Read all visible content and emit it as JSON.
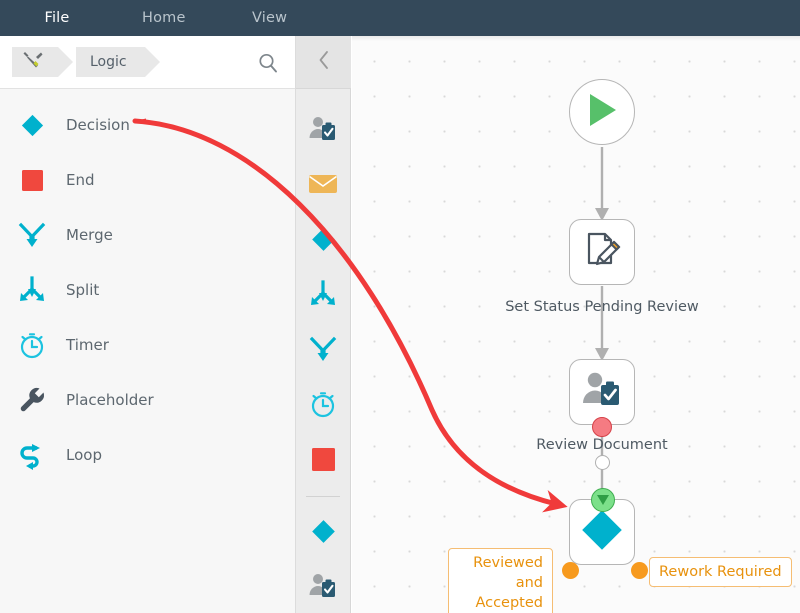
{
  "menubar": {
    "items": [
      {
        "label": "File",
        "active": true
      },
      {
        "label": "Home",
        "active": false
      },
      {
        "label": "View",
        "active": false
      }
    ]
  },
  "breadcrumb": {
    "home_icon": "tools-icon",
    "current": "Logic",
    "search_icon": "search-icon"
  },
  "sidebar": {
    "collapse_icon": "chevron-left-icon",
    "items": [
      {
        "label": "Decision",
        "icon": "diamond-icon",
        "color": "#00b1cd"
      },
      {
        "label": "End",
        "icon": "square-icon",
        "color": "#f0483e"
      },
      {
        "label": "Merge",
        "icon": "merge-arrow-icon",
        "color": "#00b1cd"
      },
      {
        "label": "Split",
        "icon": "split-arrow-icon",
        "color": "#00b1cd"
      },
      {
        "label": "Timer",
        "icon": "alarm-clock-icon",
        "color": "#1cc3e0"
      },
      {
        "label": "Placeholder",
        "icon": "wrench-icon",
        "color": "#4a5560"
      },
      {
        "label": "Loop",
        "icon": "loop-icon",
        "color": "#00b1cd"
      }
    ]
  },
  "toolstrip": {
    "items": [
      {
        "name": "user-task-icon"
      },
      {
        "name": "envelope-icon"
      },
      {
        "name": "diamond-icon"
      },
      {
        "name": "split-arrow-icon"
      },
      {
        "name": "merge-arrow-icon"
      },
      {
        "name": "alarm-clock-icon"
      },
      {
        "name": "square-end-icon"
      },
      {
        "name": "divider"
      },
      {
        "name": "diamond-icon"
      },
      {
        "name": "user-task-icon"
      }
    ]
  },
  "canvas": {
    "nodes": [
      {
        "id": "start",
        "type": "start",
        "icon": "play-icon",
        "label": ""
      },
      {
        "id": "set-status",
        "type": "task",
        "icon": "document-edit-icon",
        "label": "Set Status Pending Review"
      },
      {
        "id": "review",
        "type": "user-task",
        "icon": "user-task-icon",
        "label": "Review Document"
      },
      {
        "id": "decision",
        "type": "decision",
        "icon": "diamond-icon",
        "label": ""
      }
    ],
    "branch_labels": [
      {
        "text": "Reviewed and Accepted",
        "side": "left"
      },
      {
        "text": "Rework Required",
        "side": "right"
      }
    ]
  },
  "annotation": {
    "arrow": "red-curved-arrow",
    "color": "#f03a3a",
    "from": "Decision",
    "to": "decision-node"
  },
  "colors": {
    "menubar_bg": "#34495a",
    "accent_cyan": "#00b1cd",
    "accent_orange": "#f79a1e",
    "accent_red": "#f0483e",
    "accent_green": "#57c06a",
    "label_orange": "#e8920e",
    "canvas_bg": "#fbfbfb"
  }
}
